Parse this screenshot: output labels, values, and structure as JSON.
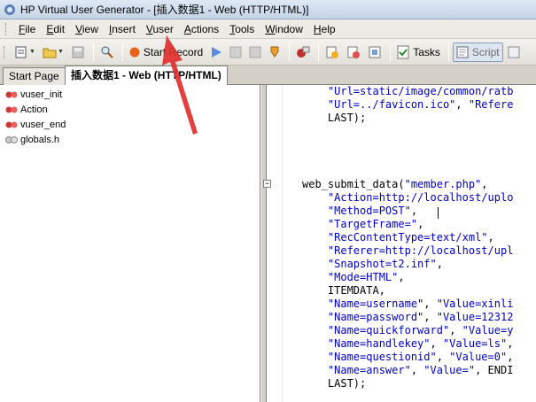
{
  "window": {
    "title": "HP Virtual User Generator - [插入数据1 - Web (HTTP/HTML)]"
  },
  "menu": [
    {
      "label": "File",
      "ul": "F",
      "rest": "ile"
    },
    {
      "label": "Edit",
      "ul": "E",
      "rest": "dit"
    },
    {
      "label": "View",
      "ul": "V",
      "rest": "iew"
    },
    {
      "label": "Insert",
      "ul": "I",
      "rest": "nsert"
    },
    {
      "label": "Vuser",
      "ul": "V",
      "rest": "user"
    },
    {
      "label": "Actions",
      "ul": "A",
      "rest": "ctions"
    },
    {
      "label": "Tools",
      "ul": "T",
      "rest": "ools"
    },
    {
      "label": "Window",
      "ul": "W",
      "rest": "indow"
    },
    {
      "label": "Help",
      "ul": "H",
      "rest": "elp"
    }
  ],
  "toolbar": {
    "start_record": "Start Record",
    "tasks": "Tasks",
    "script": "Script"
  },
  "tabs": [
    {
      "label": "Start Page"
    },
    {
      "label": "插入数据1 - Web (HTTP/HTML)"
    }
  ],
  "tree": [
    {
      "label": "vuser_init",
      "icon": "action-icon"
    },
    {
      "label": "Action",
      "icon": "action-icon"
    },
    {
      "label": "vuser_end",
      "icon": "action-icon"
    },
    {
      "label": "globals.h",
      "icon": "header-file-icon"
    }
  ],
  "code": [
    "    \"Url=static/image/common/ratb",
    "    \"Url=../favicon.ico\", \"Refere",
    "    LAST);",
    "",
    "",
    "",
    "",
    "web_submit_data(\"member.php\",",
    "    \"Action=http://localhost/uplo",
    "    \"Method=POST\",",
    "    \"TargetFrame=\",",
    "    \"RecContentType=text/xml\",",
    "    \"Referer=http://localhost/upl",
    "    \"Snapshot=t2.inf\",",
    "    \"Mode=HTML\",",
    "    ITEMDATA,",
    "    \"Name=username\", \"Value=xinli",
    "    \"Name=password\", \"Value=12312",
    "    \"Name=quickforward\", \"Value=y",
    "    \"Name=handlekey\", \"Value=ls\",",
    "    \"Name=questionid\", \"Value=0\",",
    "    \"Name=answer\", \"Value=\", ENDI",
    "    LAST);"
  ],
  "colors": {
    "annotation_arrow": "#e0302e",
    "string": "#0000c0"
  }
}
